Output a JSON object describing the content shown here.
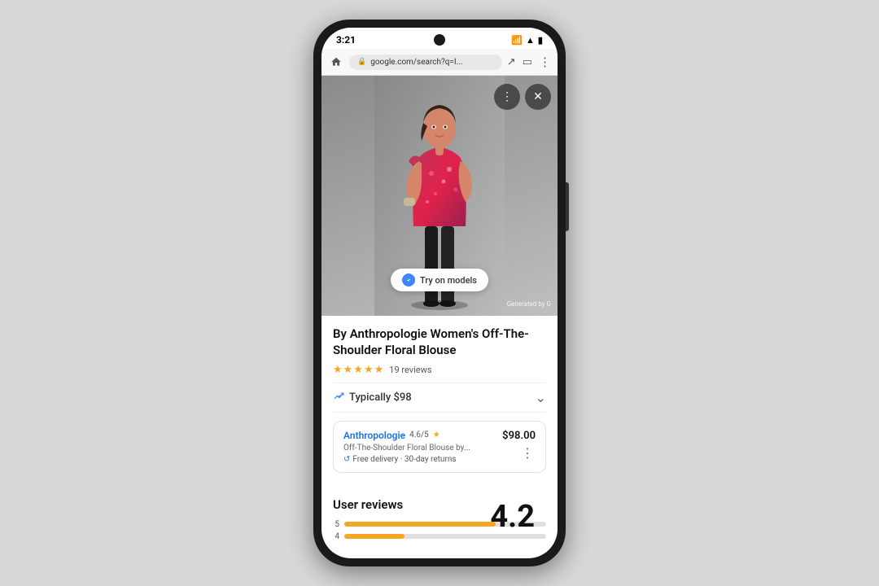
{
  "status": {
    "time": "3:21",
    "url": "google.com/search?q=I...",
    "signal_icon": "📶",
    "battery_icon": "🔋"
  },
  "overlay": {
    "more_label": "⋮",
    "close_label": "✕"
  },
  "try_on": {
    "label": "Try on models"
  },
  "generated": {
    "label": "Generated by G"
  },
  "product": {
    "title": "By Anthropologie Women's Off-The-Shoulder Floral Blouse",
    "stars": "★★★★★",
    "rating_value": "4.5",
    "reviews_count": "19 reviews",
    "typically_label": "Typically $98",
    "chevron": "⌄"
  },
  "merchant": {
    "name": "Anthropologie",
    "rating": "4.6/5",
    "star": "★",
    "price": "$98.00",
    "description": "Off-The-Shoulder Floral Blouse by...",
    "shipping": "Free delivery · 30-day returns",
    "more": "⋮"
  },
  "reviews": {
    "title": "User reviews",
    "big_rating": "4.2",
    "bars": [
      {
        "label": "5",
        "fill_pct": 75
      },
      {
        "label": "4",
        "fill_pct": 30
      }
    ]
  }
}
